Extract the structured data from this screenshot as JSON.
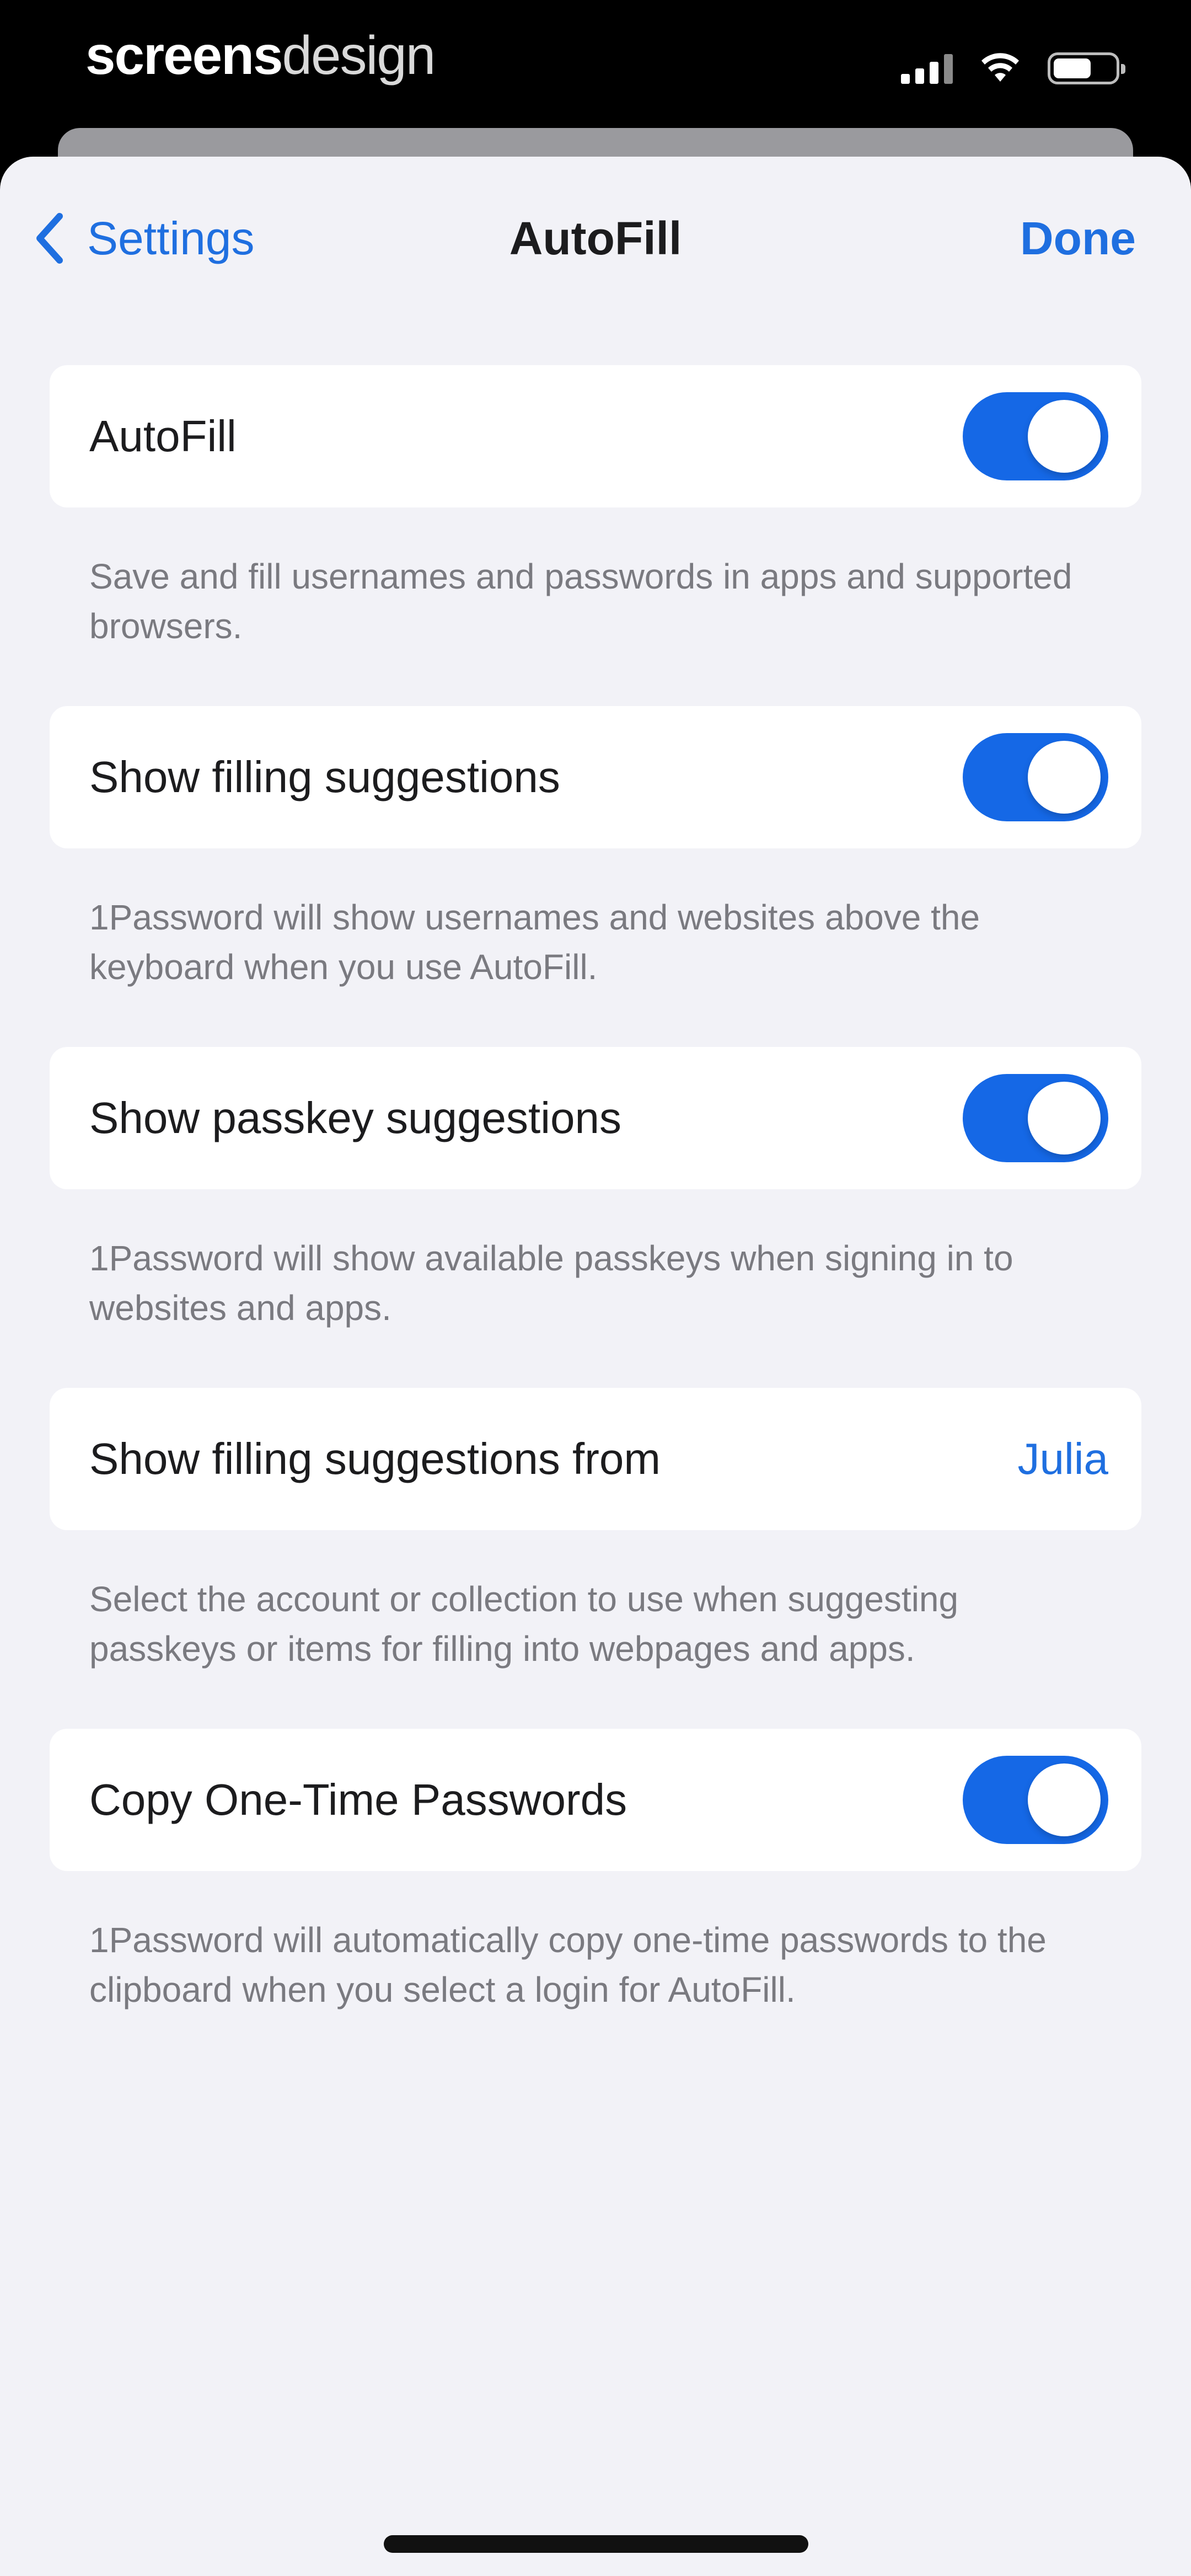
{
  "watermark": {
    "bold": "screens",
    "light": "design"
  },
  "status_bar": {
    "signal_icon": "cellular-signal-icon",
    "wifi_icon": "wifi-icon",
    "battery_icon": "battery-icon"
  },
  "nav": {
    "back_label": "Settings",
    "back_icon": "chevron-left-icon",
    "title": "AutoFill",
    "done_label": "Done"
  },
  "colors": {
    "accent": "#1f6fe0",
    "toggle_on": "#1568e6",
    "background": "#f2f2f7",
    "footer_text": "#7a7a80"
  },
  "sections": [
    {
      "label": "AutoFill",
      "control": "toggle",
      "on": true,
      "footer": "Save and fill usernames and passwords in apps and supported browsers."
    },
    {
      "label": "Show filling suggestions",
      "control": "toggle",
      "on": true,
      "footer": "1Password will show usernames and websites above the keyboard when you use AutoFill."
    },
    {
      "label": "Show passkey suggestions",
      "control": "toggle",
      "on": true,
      "footer": "1Password will show available passkeys when signing in to websites and apps."
    },
    {
      "label": "Show filling suggestions from",
      "control": "value",
      "value": "Julia",
      "footer": "Select the account or collection to use when suggesting passkeys or items for filling into webpages and apps."
    },
    {
      "label": "Copy One-Time Passwords",
      "control": "toggle",
      "on": true,
      "footer": "1Password will automatically copy one-time passwords to the clipboard when you select a login for AutoFill."
    }
  ]
}
